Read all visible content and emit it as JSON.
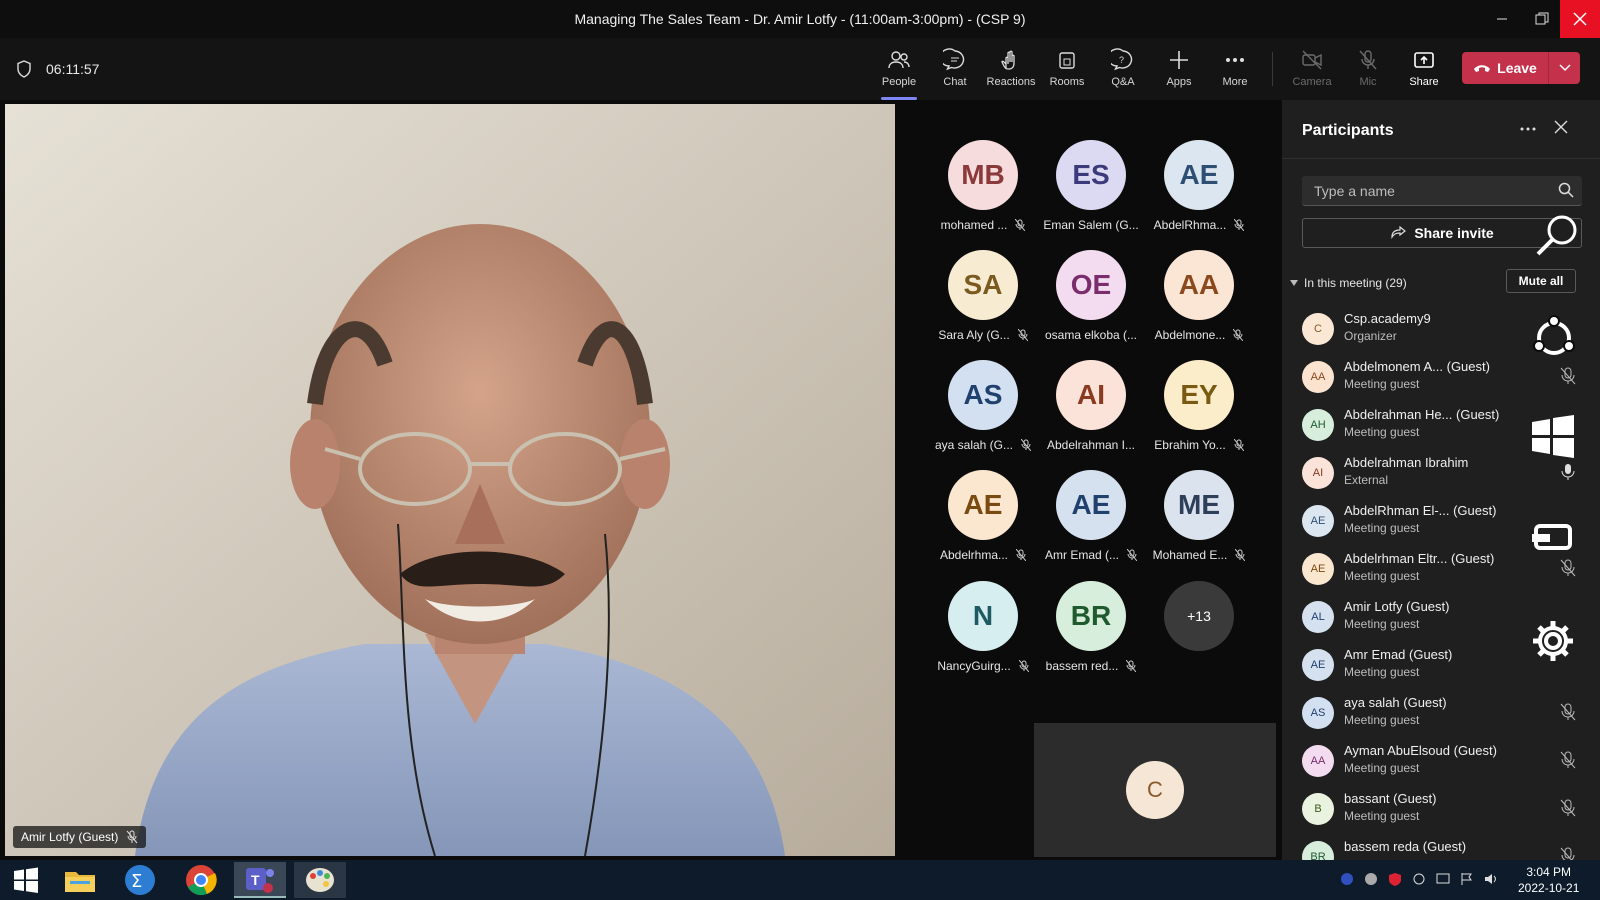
{
  "window": {
    "title": "Managing The Sales Team - Dr. Amir Lotfy - (11:00am-3:00pm) - (CSP 9)"
  },
  "toolbar": {
    "timer": "06:11:57",
    "buttons": [
      {
        "label": "People",
        "icon": "people-icon"
      },
      {
        "label": "Chat",
        "icon": "chat-icon"
      },
      {
        "label": "Reactions",
        "icon": "reactions-icon"
      },
      {
        "label": "Rooms",
        "icon": "rooms-icon"
      },
      {
        "label": "Q&A",
        "icon": "qna-icon"
      },
      {
        "label": "Apps",
        "icon": "plus-icon"
      },
      {
        "label": "More",
        "icon": "more-icon"
      },
      {
        "label": "Camera",
        "icon": "camera-off-icon"
      },
      {
        "label": "Mic",
        "icon": "mic-off-icon"
      },
      {
        "label": "Share",
        "icon": "share-icon"
      }
    ],
    "leave_label": "Leave"
  },
  "video": {
    "speaker_name": "Amir Lotfy (Guest)"
  },
  "gallery": {
    "tiles": [
      {
        "initials": "MB",
        "name": "mohamed ...",
        "bg": "#f6dcdc",
        "fg": "#8a3a3a"
      },
      {
        "initials": "ES",
        "name": "Eman Salem (G...",
        "bg": "#dcdaf2",
        "fg": "#3b3a7a"
      },
      {
        "initials": "AE",
        "name": "AbdelRhma...",
        "bg": "#dbe6f0",
        "fg": "#2e4f73"
      },
      {
        "initials": "SA",
        "name": "Sara Aly (G...",
        "bg": "#f7ebd2",
        "fg": "#7a5a1e"
      },
      {
        "initials": "OE",
        "name": "osama elkoba (...",
        "bg": "#f3dcef",
        "fg": "#7a2d6c"
      },
      {
        "initials": "AA",
        "name": "Abdelmone...",
        "bg": "#fbe6d6",
        "fg": "#8a4a1e"
      },
      {
        "initials": "AS",
        "name": "aya salah (G...",
        "bg": "#d3e0f2",
        "fg": "#20406e"
      },
      {
        "initials": "AI",
        "name": "Abdelrahman I...",
        "bg": "#fbe3d9",
        "fg": "#8a3a1e"
      },
      {
        "initials": "EY",
        "name": "Ebrahim Yo...",
        "bg": "#fbedc9",
        "fg": "#7a5a10"
      },
      {
        "initials": "AE",
        "name": "Abdelrhma...",
        "bg": "#fbe7cf",
        "fg": "#7a4a10"
      },
      {
        "initials": "AE",
        "name": "Amr Emad (...",
        "bg": "#d6e1f0",
        "fg": "#20406e"
      },
      {
        "initials": "ME",
        "name": "Mohamed E...",
        "bg": "#dbe3ee",
        "fg": "#2e3f5a"
      },
      {
        "initials": "N",
        "name": "NancyGuirg...",
        "bg": "#d6eef0",
        "fg": "#1e5a62"
      },
      {
        "initials": "BR",
        "name": "bassem red...",
        "bg": "#d8eedc",
        "fg": "#1e5a2e"
      }
    ],
    "more_label": "+13",
    "self_initials": "C"
  },
  "participants": {
    "title": "Participants",
    "search_placeholder": "Type a name",
    "share_invite_label": "Share invite",
    "section_label": "In this meeting (29)",
    "mute_all_label": "Mute all",
    "people": [
      {
        "initials": "C",
        "name": "Csp.academy9",
        "role": "Organizer",
        "bg": "#fbe7d3",
        "fg": "#8a5a2a"
      },
      {
        "initials": "AA",
        "name": "Abdelmonem A... (Guest)",
        "role": "Meeting guest",
        "bg": "#fbe3d0",
        "fg": "#8a4a1e"
      },
      {
        "initials": "AH",
        "name": "Abdelrahman He... (Guest)",
        "role": "Meeting guest",
        "bg": "#d8eedc",
        "fg": "#1e5a2e"
      },
      {
        "initials": "AI",
        "name": "Abdelrahman Ibrahim",
        "role": "External",
        "bg": "#fbe3d9",
        "fg": "#8a3a1e"
      },
      {
        "initials": "AE",
        "name": "AbdelRhman El-... (Guest)",
        "role": "Meeting guest",
        "bg": "#dbe6f0",
        "fg": "#2e4f73"
      },
      {
        "initials": "AE",
        "name": "Abdelrhman Eltr... (Guest)",
        "role": "Meeting guest",
        "bg": "#fbe7cf",
        "fg": "#7a4a10"
      },
      {
        "initials": "AL",
        "name": "Amir Lotfy (Guest)",
        "role": "Meeting guest",
        "bg": "#d6e1f0",
        "fg": "#20406e"
      },
      {
        "initials": "AE",
        "name": "Amr Emad (Guest)",
        "role": "Meeting guest",
        "bg": "#d6e1f0",
        "fg": "#20406e"
      },
      {
        "initials": "AS",
        "name": "aya salah (Guest)",
        "role": "Meeting guest",
        "bg": "#d3e0f2",
        "fg": "#20406e"
      },
      {
        "initials": "AA",
        "name": "Ayman AbuElsoud (Guest)",
        "role": "Meeting guest",
        "bg": "#f3dcef",
        "fg": "#7a2d6c"
      },
      {
        "initials": "B",
        "name": "bassant (Guest)",
        "role": "Meeting guest",
        "bg": "#eaf2e0",
        "fg": "#3a5a1e"
      },
      {
        "initials": "BR",
        "name": "bassem reda (Guest)",
        "role": "",
        "bg": "#d8eedc",
        "fg": "#1e5a2e"
      }
    ]
  },
  "taskbar": {
    "time": "3:04 PM",
    "date": "2022-10-21"
  },
  "colors": {
    "accent": "#7f85f5",
    "leave": "#c4314b",
    "close": "#e81123"
  }
}
